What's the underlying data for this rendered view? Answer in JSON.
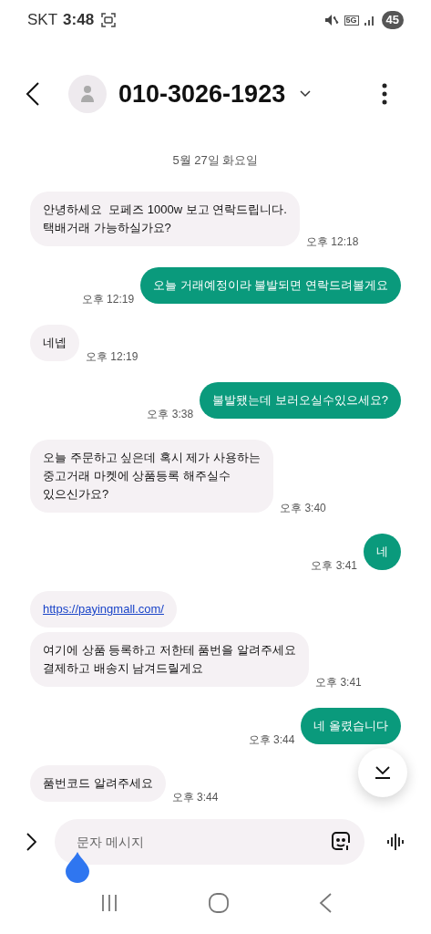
{
  "status_bar": {
    "carrier": "SKT",
    "time": "3:48",
    "network": "5G",
    "battery": "45"
  },
  "header": {
    "title": "010-3026-1923"
  },
  "date_divider": "5월 27일 화요일",
  "messages": [
    {
      "sent": false,
      "kind": "text",
      "text": "안녕하세요  모페즈 1000w 보고 연락드립니다.\n택배거래 가능하실가요?",
      "time": "오후 12:18"
    },
    {
      "sent": true,
      "kind": "text",
      "text": "오늘 거래예정이라 불발되면 연락드려볼게요",
      "time": "오후 12:19"
    },
    {
      "sent": false,
      "kind": "text",
      "text": "네넵",
      "time": "오후 12:19"
    },
    {
      "sent": true,
      "kind": "text",
      "text": "불발됐는데 보러오실수있으세요?",
      "time": "오후 3:38"
    },
    {
      "sent": false,
      "kind": "text",
      "text": "오늘 주문하고 싶은데 혹시 제가 사용하는\n중고거래 마켓에 상품등록 해주실수\n있으신가요?",
      "time": "오후 3:40"
    },
    {
      "sent": true,
      "kind": "text",
      "text": "네",
      "time": "오후 3:41"
    },
    {
      "sent": false,
      "kind": "link",
      "text": "https://payingmall.com/"
    },
    {
      "sent": false,
      "kind": "text",
      "text": "여기에 상품 등록하고 저한테 품번을 알려주세요\n결제하고 배송지 남겨드릴게요",
      "time": "오후 3:41"
    },
    {
      "sent": true,
      "kind": "text",
      "text": "네 올렸습니다",
      "time": "오후 3:44"
    },
    {
      "sent": false,
      "kind": "text",
      "text": "품번코드 알려주세요",
      "time": "오후 3:44"
    }
  ],
  "composer": {
    "placeholder": "문자 메시지"
  }
}
